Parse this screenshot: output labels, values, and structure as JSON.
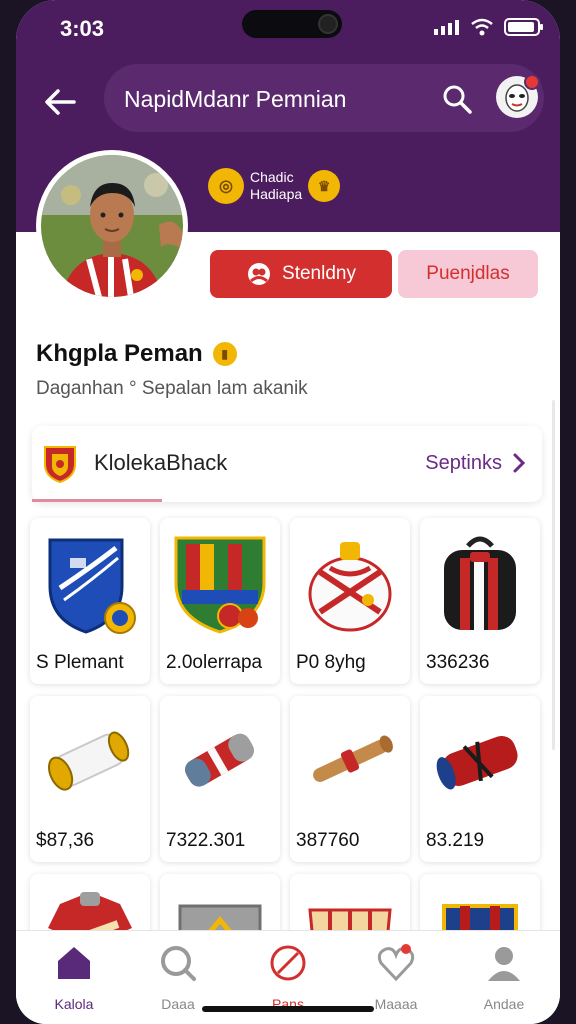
{
  "status": {
    "time": "3:03"
  },
  "header": {
    "title": "NapidMdanr Pemnian"
  },
  "profile": {
    "badge_line1": "Chadic",
    "badge_line2": "Hadiapa",
    "primary_button": "Stenldny",
    "secondary_button": "Puenjdlas",
    "name": "Khgpla Peman",
    "subtitle": "Daganhan ° Sepalan lam akanik"
  },
  "club": {
    "name": "KlolekaBhack",
    "link": "Septinks"
  },
  "products": [
    {
      "label": "S Plemant",
      "icon": "crest-icon"
    },
    {
      "label": "2.0olerrapa",
      "icon": "crest-icon"
    },
    {
      "label": "P0 8yhg",
      "icon": "jersey-icon"
    },
    {
      "label": "336236",
      "icon": "backpack-icon"
    },
    {
      "label": "$87,36",
      "icon": "scroll-icon"
    },
    {
      "label": "7322.301",
      "icon": "scarf-roll-icon"
    },
    {
      "label": "387760",
      "icon": "bat-icon"
    },
    {
      "label": "83.219",
      "icon": "scarf-roll-icon"
    },
    {
      "label": "",
      "icon": "jersey-icon"
    },
    {
      "label": "",
      "icon": "shield-icon"
    },
    {
      "label": "",
      "icon": "basket-icon"
    },
    {
      "label": "",
      "icon": "crest-icon"
    }
  ],
  "nav": [
    {
      "label": "Kalola",
      "icon": "home-icon"
    },
    {
      "label": "Daaa",
      "icon": "search-icon"
    },
    {
      "label": "Pans",
      "icon": "block-icon"
    },
    {
      "label": "Maaaa",
      "icon": "heart-icon"
    },
    {
      "label": "Andae",
      "icon": "profile-icon"
    }
  ],
  "colors": {
    "brand": "#4c1d5e",
    "accent": "#d32f2f",
    "link": "#6a2a86",
    "active_nav": "#5a2a7a"
  }
}
